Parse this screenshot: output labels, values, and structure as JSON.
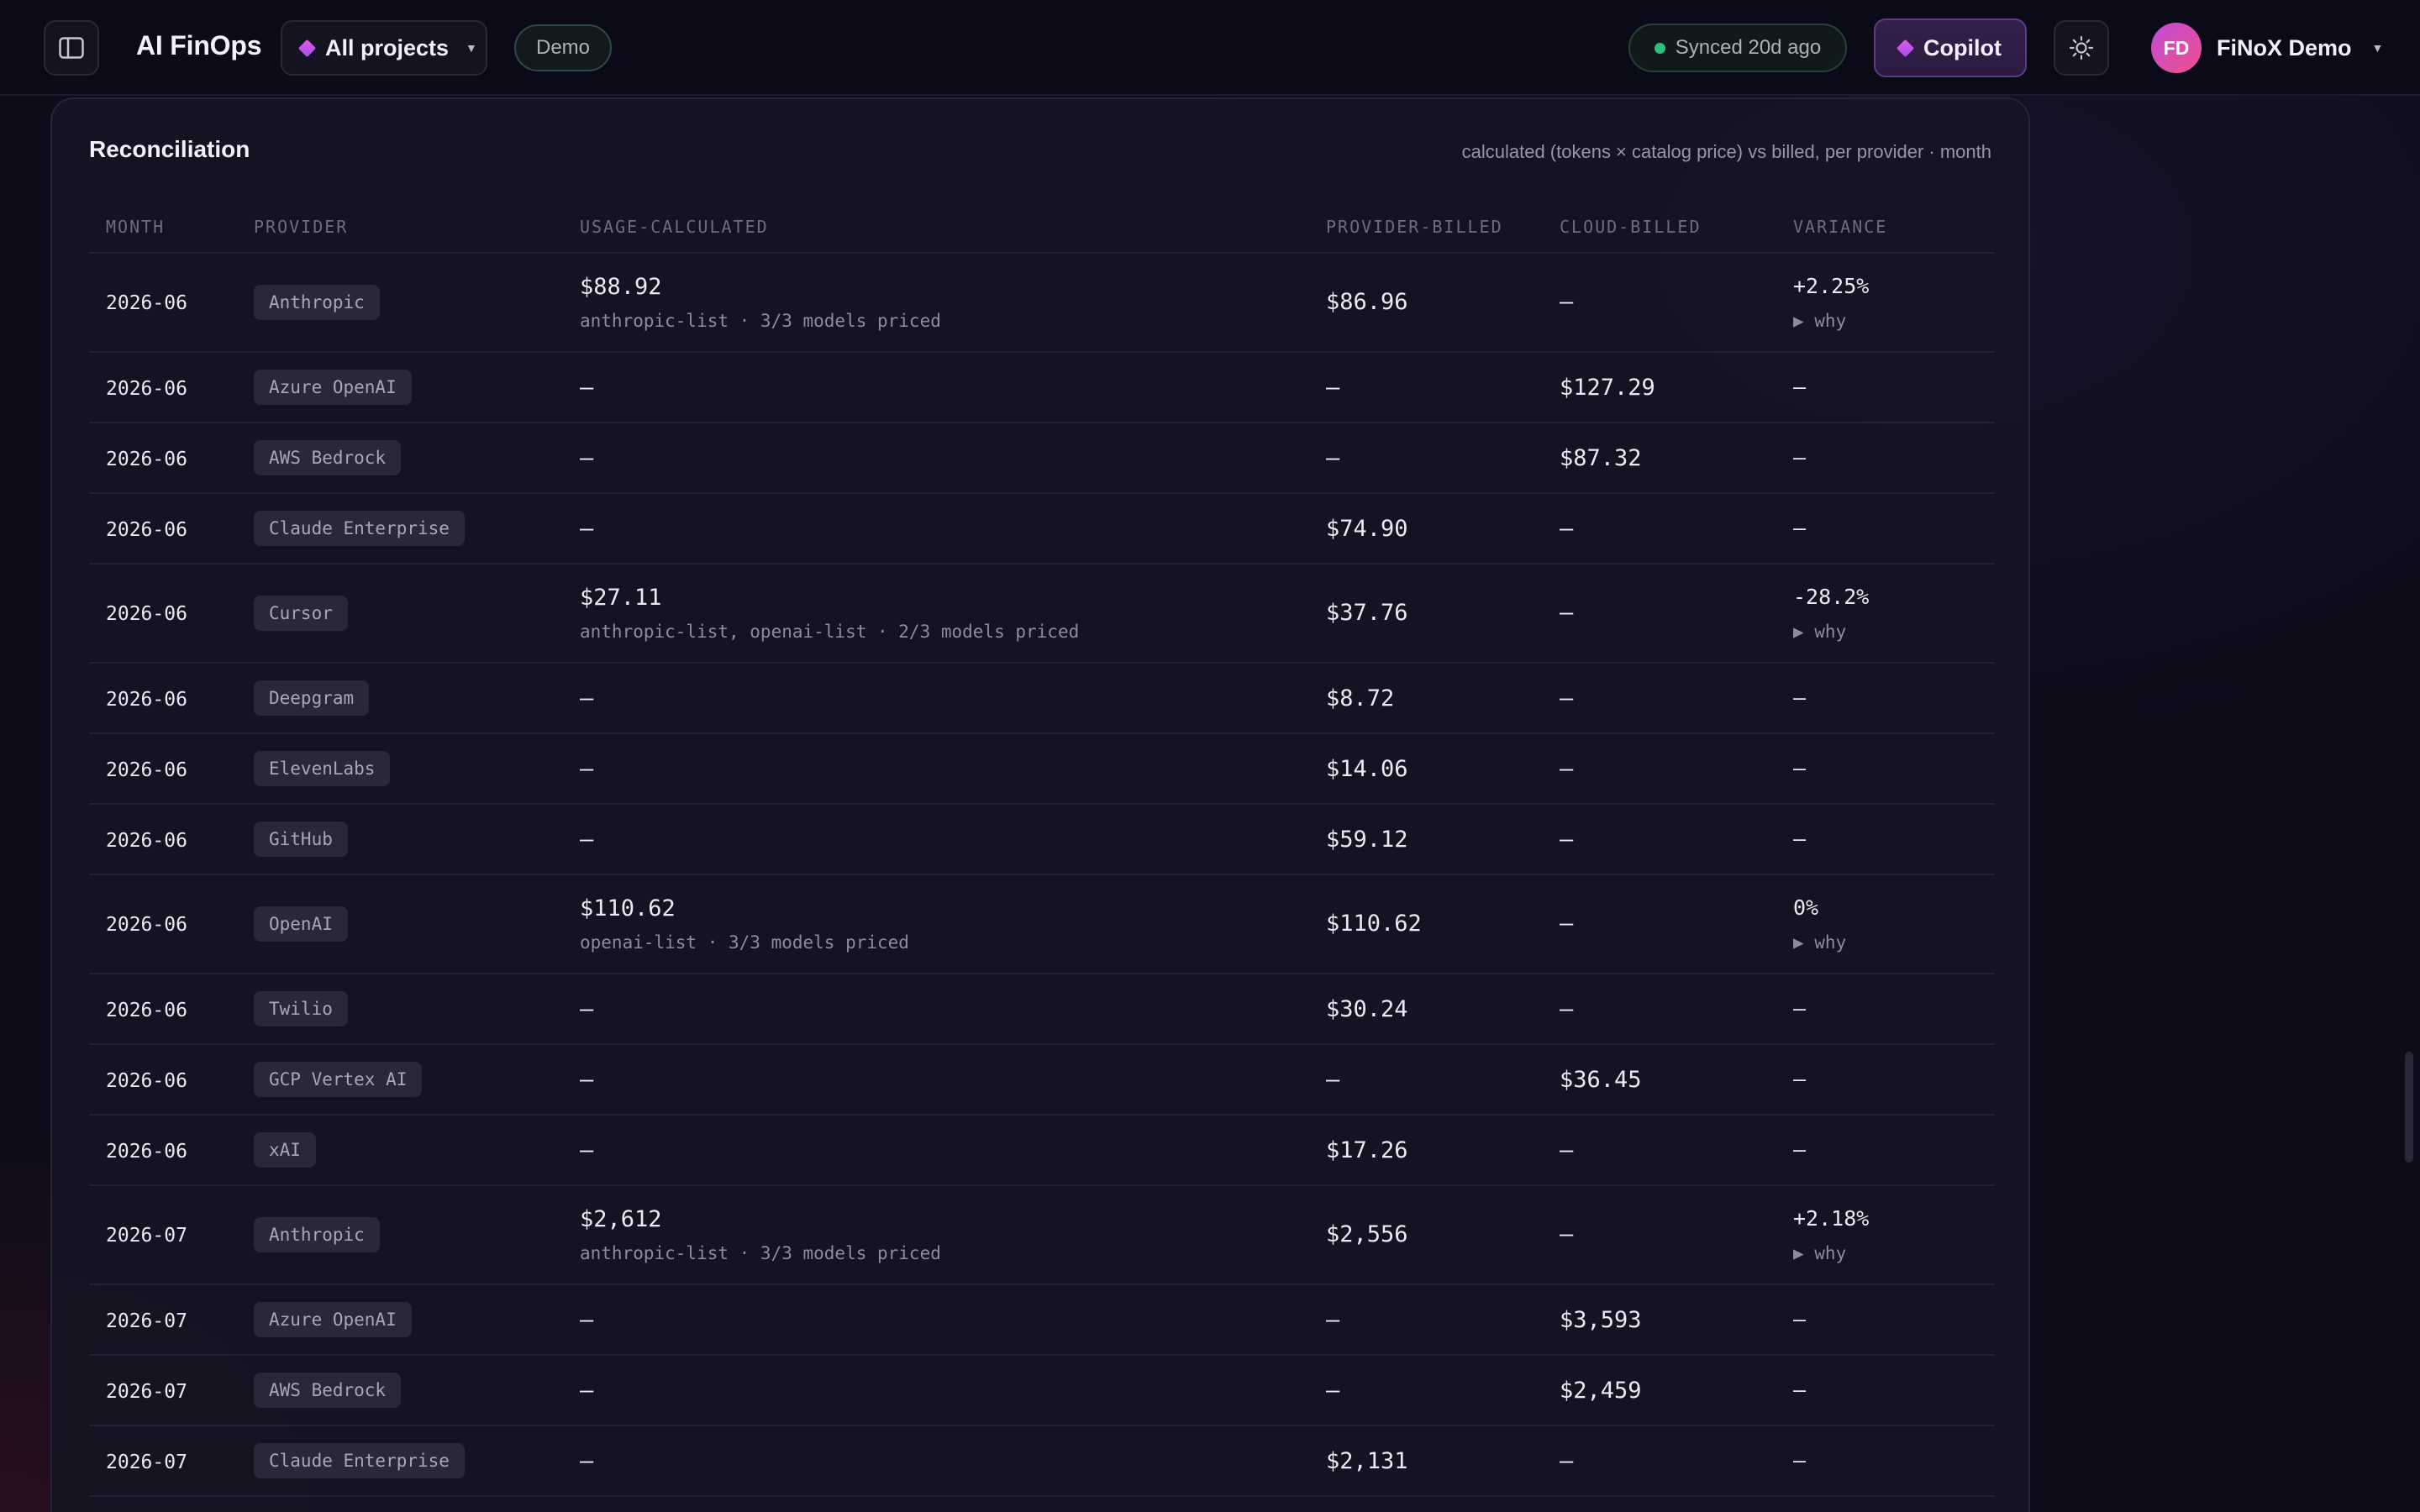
{
  "header": {
    "app_title": "AI FinOps",
    "project_label": "All projects",
    "demo_label": "Demo",
    "sync_label": "Synced 20d ago",
    "copilot_label": "Copilot",
    "user_initials": "FD",
    "user_name": "FiNoX Demo",
    "sync_color": "#2ec07a",
    "accent_color": "#c04bd8"
  },
  "card": {
    "title": "Reconciliation",
    "subtitle": "calculated (tokens × catalog price) vs billed, per provider · month"
  },
  "table": {
    "columns": [
      "MONTH",
      "PROVIDER",
      "USAGE-CALCULATED",
      "PROVIDER-BILLED",
      "CLOUD-BILLED",
      "VARIANCE"
    ],
    "rows": [
      {
        "month": "2026-06",
        "provider": "Anthropic",
        "usage": "$88.92",
        "usage_sub": "anthropic-list · 3/3 models priced",
        "provider_billed": "$86.96",
        "cloud_billed": "—",
        "variance": "+2.25%",
        "why": "▶ why"
      },
      {
        "month": "2026-06",
        "provider": "Azure OpenAI",
        "usage": "—",
        "usage_sub": "",
        "provider_billed": "—",
        "cloud_billed": "$127.29",
        "variance": "—",
        "why": ""
      },
      {
        "month": "2026-06",
        "provider": "AWS Bedrock",
        "usage": "—",
        "usage_sub": "",
        "provider_billed": "—",
        "cloud_billed": "$87.32",
        "variance": "—",
        "why": ""
      },
      {
        "month": "2026-06",
        "provider": "Claude Enterprise",
        "usage": "—",
        "usage_sub": "",
        "provider_billed": "$74.90",
        "cloud_billed": "—",
        "variance": "—",
        "why": ""
      },
      {
        "month": "2026-06",
        "provider": "Cursor",
        "usage": "$27.11",
        "usage_sub": "anthropic-list, openai-list · 2/3 models priced",
        "provider_billed": "$37.76",
        "cloud_billed": "—",
        "variance": "-28.2%",
        "why": "▶ why"
      },
      {
        "month": "2026-06",
        "provider": "Deepgram",
        "usage": "—",
        "usage_sub": "",
        "provider_billed": "$8.72",
        "cloud_billed": "—",
        "variance": "—",
        "why": ""
      },
      {
        "month": "2026-06",
        "provider": "ElevenLabs",
        "usage": "—",
        "usage_sub": "",
        "provider_billed": "$14.06",
        "cloud_billed": "—",
        "variance": "—",
        "why": ""
      },
      {
        "month": "2026-06",
        "provider": "GitHub",
        "usage": "—",
        "usage_sub": "",
        "provider_billed": "$59.12",
        "cloud_billed": "—",
        "variance": "—",
        "why": ""
      },
      {
        "month": "2026-06",
        "provider": "OpenAI",
        "usage": "$110.62",
        "usage_sub": "openai-list · 3/3 models priced",
        "provider_billed": "$110.62",
        "cloud_billed": "—",
        "variance": "0%",
        "why": "▶ why"
      },
      {
        "month": "2026-06",
        "provider": "Twilio",
        "usage": "—",
        "usage_sub": "",
        "provider_billed": "$30.24",
        "cloud_billed": "—",
        "variance": "—",
        "why": ""
      },
      {
        "month": "2026-06",
        "provider": "GCP Vertex AI",
        "usage": "—",
        "usage_sub": "",
        "provider_billed": "—",
        "cloud_billed": "$36.45",
        "variance": "—",
        "why": ""
      },
      {
        "month": "2026-06",
        "provider": "xAI",
        "usage": "—",
        "usage_sub": "",
        "provider_billed": "$17.26",
        "cloud_billed": "—",
        "variance": "—",
        "why": ""
      },
      {
        "month": "2026-07",
        "provider": "Anthropic",
        "usage": "$2,612",
        "usage_sub": "anthropic-list · 3/3 models priced",
        "provider_billed": "$2,556",
        "cloud_billed": "—",
        "variance": "+2.18%",
        "why": "▶ why"
      },
      {
        "month": "2026-07",
        "provider": "Azure OpenAI",
        "usage": "—",
        "usage_sub": "",
        "provider_billed": "—",
        "cloud_billed": "$3,593",
        "variance": "—",
        "why": ""
      },
      {
        "month": "2026-07",
        "provider": "AWS Bedrock",
        "usage": "—",
        "usage_sub": "",
        "provider_billed": "—",
        "cloud_billed": "$2,459",
        "variance": "—",
        "why": ""
      },
      {
        "month": "2026-07",
        "provider": "Claude Enterprise",
        "usage": "—",
        "usage_sub": "",
        "provider_billed": "$2,131",
        "cloud_billed": "—",
        "variance": "—",
        "why": ""
      }
    ]
  }
}
